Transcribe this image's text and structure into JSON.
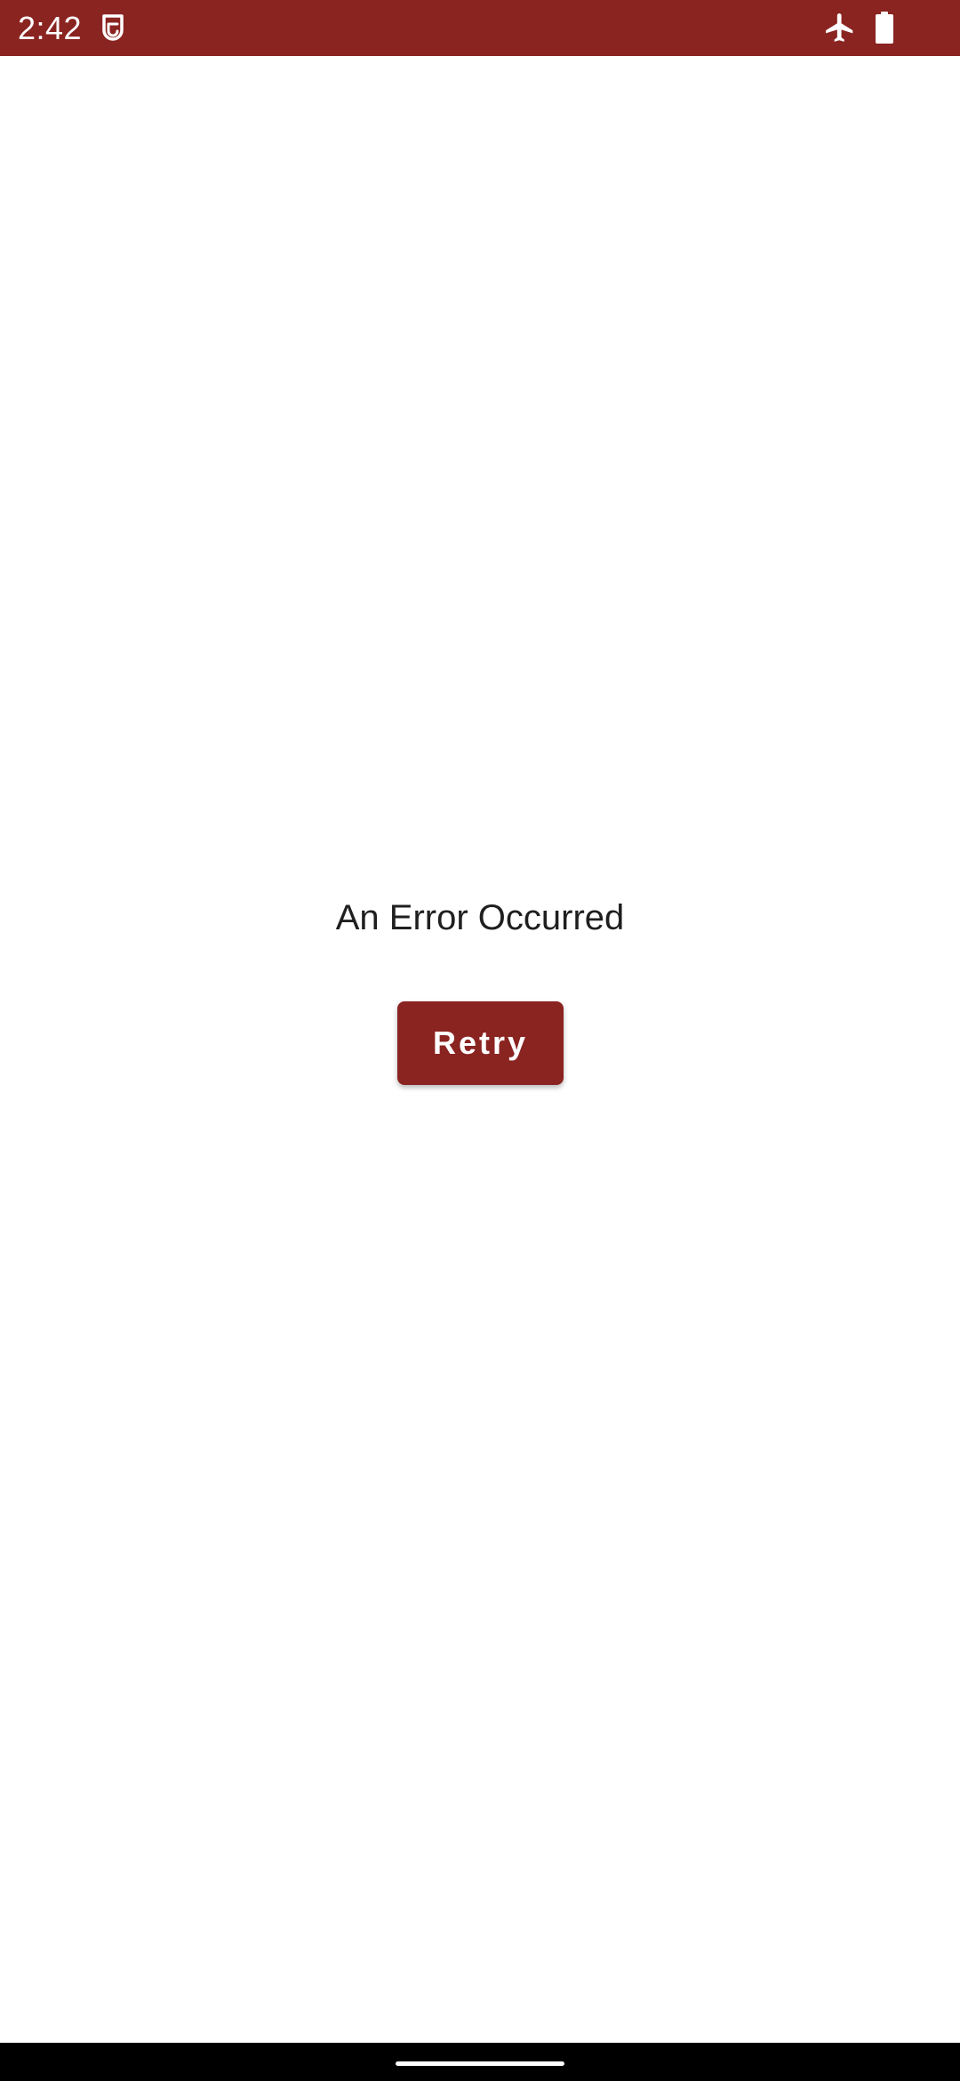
{
  "status_bar": {
    "time": "2:42",
    "background_color": "#8a2421",
    "icons": [
      "sim-card-icon",
      "airplane-mode-icon",
      "battery-full-icon"
    ]
  },
  "main": {
    "error_message": "An Error Occurred",
    "retry_label": "Retry",
    "accent_color": "#8a2421"
  },
  "nav_bar": {
    "background_color": "#000000"
  }
}
